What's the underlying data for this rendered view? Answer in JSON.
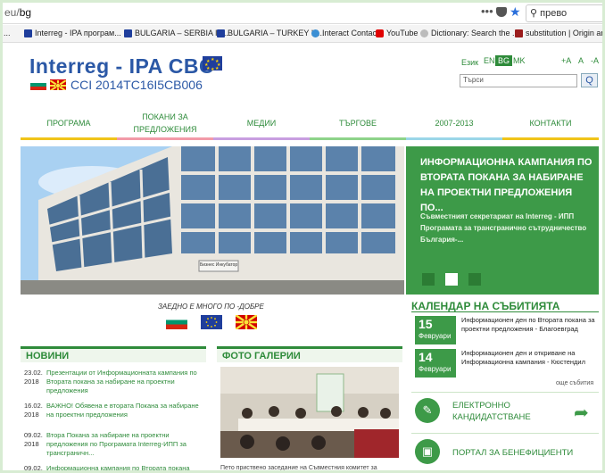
{
  "browser": {
    "url_prefix": "eu/",
    "url_path": "bg",
    "menu_glyph": "•••",
    "search_value": "прево",
    "bookmarks": [
      {
        "label": "...",
        "icon": "ellipsis",
        "color": "#888888"
      },
      {
        "label": "Interreg - IPA програм...",
        "icon": "eu-flag-icon",
        "color": "#1f3e9c"
      },
      {
        "label": "BULGARIA – SERBIA IP...",
        "icon": "eu-flag-icon",
        "color": "#1f3e9c"
      },
      {
        "label": "BULGARIA – TURKEY IP...",
        "icon": "eu-flag-icon",
        "color": "#1f3e9c"
      },
      {
        "label": "Interact Contacts",
        "icon": "interact-icon",
        "color": "#3b8fd4"
      },
      {
        "label": "YouTube",
        "icon": "youtube-icon",
        "color": "#e00000"
      },
      {
        "label": "Dictionary: Search the ...",
        "icon": "dictionary-icon",
        "color": "#999999"
      },
      {
        "label": "substitution | Origin an...",
        "icon": "etymology-icon",
        "color": "#9b1c1c"
      }
    ]
  },
  "header": {
    "logo_title": "Interreg - IPA CBC",
    "programme_code": "CCI 2014TC16I5CB006",
    "lang_label": "Език",
    "languages": [
      "EN",
      "BG",
      "MK"
    ],
    "font_sizes": [
      "+A",
      "A",
      "-A"
    ],
    "search_placeholder": "Търси",
    "search_button": "Q"
  },
  "nav": [
    {
      "label": "ПРОГРАМА",
      "color": "#f0c419"
    },
    {
      "label": "ПОКАНИ ЗА ПРЕДЛОЖЕНИЯ",
      "color": "#f29aa8"
    },
    {
      "label": "МЕДИИ",
      "color": "#c89ee0"
    },
    {
      "label": "ТЪРГОВЕ",
      "color": "#8ed38a"
    },
    {
      "label": "2007-2013",
      "color": "#9ad6e8"
    },
    {
      "label": "КОНТАКТИ",
      "color": "#f0c419"
    }
  ],
  "hero": {
    "building_sign": "Бизнес Инкубатор"
  },
  "promo": {
    "title": "ИНФОРМАЦИОННА КАМПАНИЯ ПО ВТОРАТА ПОКАНА ЗА НАБИРАНЕ НА ПРОЕКТНИ ПРЕДЛОЖЕНИЯ ПО...",
    "text": "Съвместният секретариат на Interreg - ИПП Програмата за трансгранично сътрудничество България-...",
    "active_slide": 2,
    "slide_count": 3
  },
  "motto": "ЗАЕДНО Е МНОГО ПО -ДОБРЕ",
  "calendar": {
    "title": "КАЛЕНДАР НА СЪБИТИЯТА",
    "events": [
      {
        "day": "15",
        "month": "Февруари",
        "text": "Информационен ден по Втората покана за проектни предложения - Благоевград"
      },
      {
        "day": "14",
        "month": "Февруари",
        "text": "Информационен ден и откриване на Информационна кампания - Кюстендил"
      }
    ],
    "more": "още събития"
  },
  "services": [
    {
      "label": "ЕЛЕКТРОННО КАНДИДАТСТВАНЕ",
      "icon": "document-icon"
    },
    {
      "label": "ПОРТАЛ ЗА БЕНЕФИЦИЕНТИ",
      "icon": "briefcase-icon"
    }
  ],
  "news": {
    "title": "НОВИНИ",
    "items": [
      {
        "date": "23.02. 2018",
        "text": "Презентации от Информационната кампания по Втората покана за набиране на проектни предложения"
      },
      {
        "date": "16.02. 2018",
        "text": "ВАЖНО! Обявена е втората Покана за набиране на проектни предложения"
      },
      {
        "date": "09.02. 2018",
        "text": "Втора Покана за набиране на проектни предложения по Програмата Interreg-ИПП за трансграничн..."
      },
      {
        "date": "09.02.",
        "text": "Информационна кампания по Втората покана"
      }
    ]
  },
  "gallery": {
    "title": "ФОТО ГАЛЕРИИ",
    "caption": "Пето приствено заседание на Съвместния комитет за"
  }
}
